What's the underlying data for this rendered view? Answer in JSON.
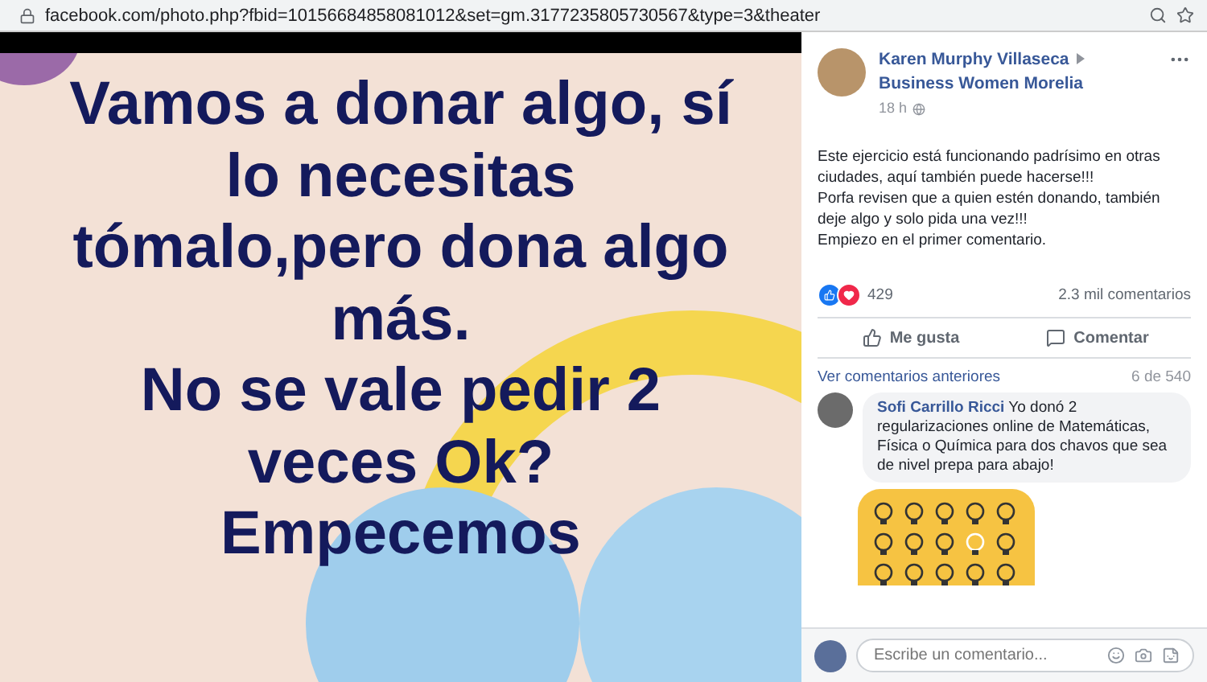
{
  "address_bar": {
    "url": "facebook.com/photo.php?fbid=10156684858081012&set=gm.3177235805730567&type=3&theater"
  },
  "photo": {
    "lines": [
      "Vamos a donar algo, sí",
      "lo necesitas",
      "tómalo,pero dona algo",
      "más.",
      "No se vale pedir 2",
      "veces Ok?",
      "Empecemos"
    ]
  },
  "post": {
    "author": "Karen Murphy Villaseca",
    "group": "Business Women Morelia",
    "time": "18 h",
    "text": [
      "Este ejercicio está funcionando padrísimo en otras ciudades, aquí también puede hacerse!!!",
      "Porfa revisen que a quien estén donando, también deje algo y solo pida una vez!!!",
      "Empiezo en el primer comentario."
    ],
    "reactions_count": "429",
    "comments_count": "2.3 mil comentarios"
  },
  "actions": [
    {
      "kind": "like",
      "label": "Me gusta"
    },
    {
      "kind": "comment",
      "label": "Comentar"
    }
  ],
  "comments_header": {
    "link": "Ver comentarios anteriores",
    "count": "6 de 540"
  },
  "comments": [
    {
      "author": "Sofi Carrillo Ricci",
      "text": "Yo donó 2 regularizaciones online de Matemáticas, Física o Química para dos chavos que sea de nivel prepa para abajo!"
    }
  ],
  "composer": {
    "placeholder": "Escribe un comentario..."
  }
}
